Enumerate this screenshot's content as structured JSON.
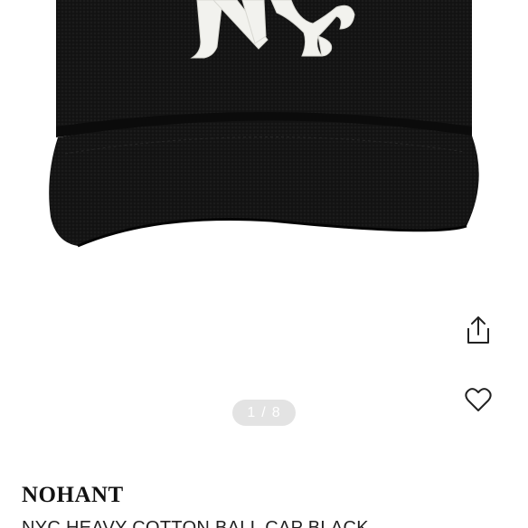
{
  "product": {
    "image": {
      "description": "black cotton ball cap with white NY-style letters",
      "logo_text": "NY"
    },
    "gallery": {
      "current": "1",
      "separator": "/",
      "total": "8"
    },
    "brand": "NOHANT",
    "name": "NYC HEAVY COTTON BALL CAP BLACK"
  },
  "actions": {
    "share_icon": "share-icon",
    "like_icon": "heart-icon"
  },
  "colors": {
    "cap": "#111111",
    "logo": "#f2f2ee",
    "indicator_bg": "#e3e3e3",
    "text": "#111111"
  }
}
